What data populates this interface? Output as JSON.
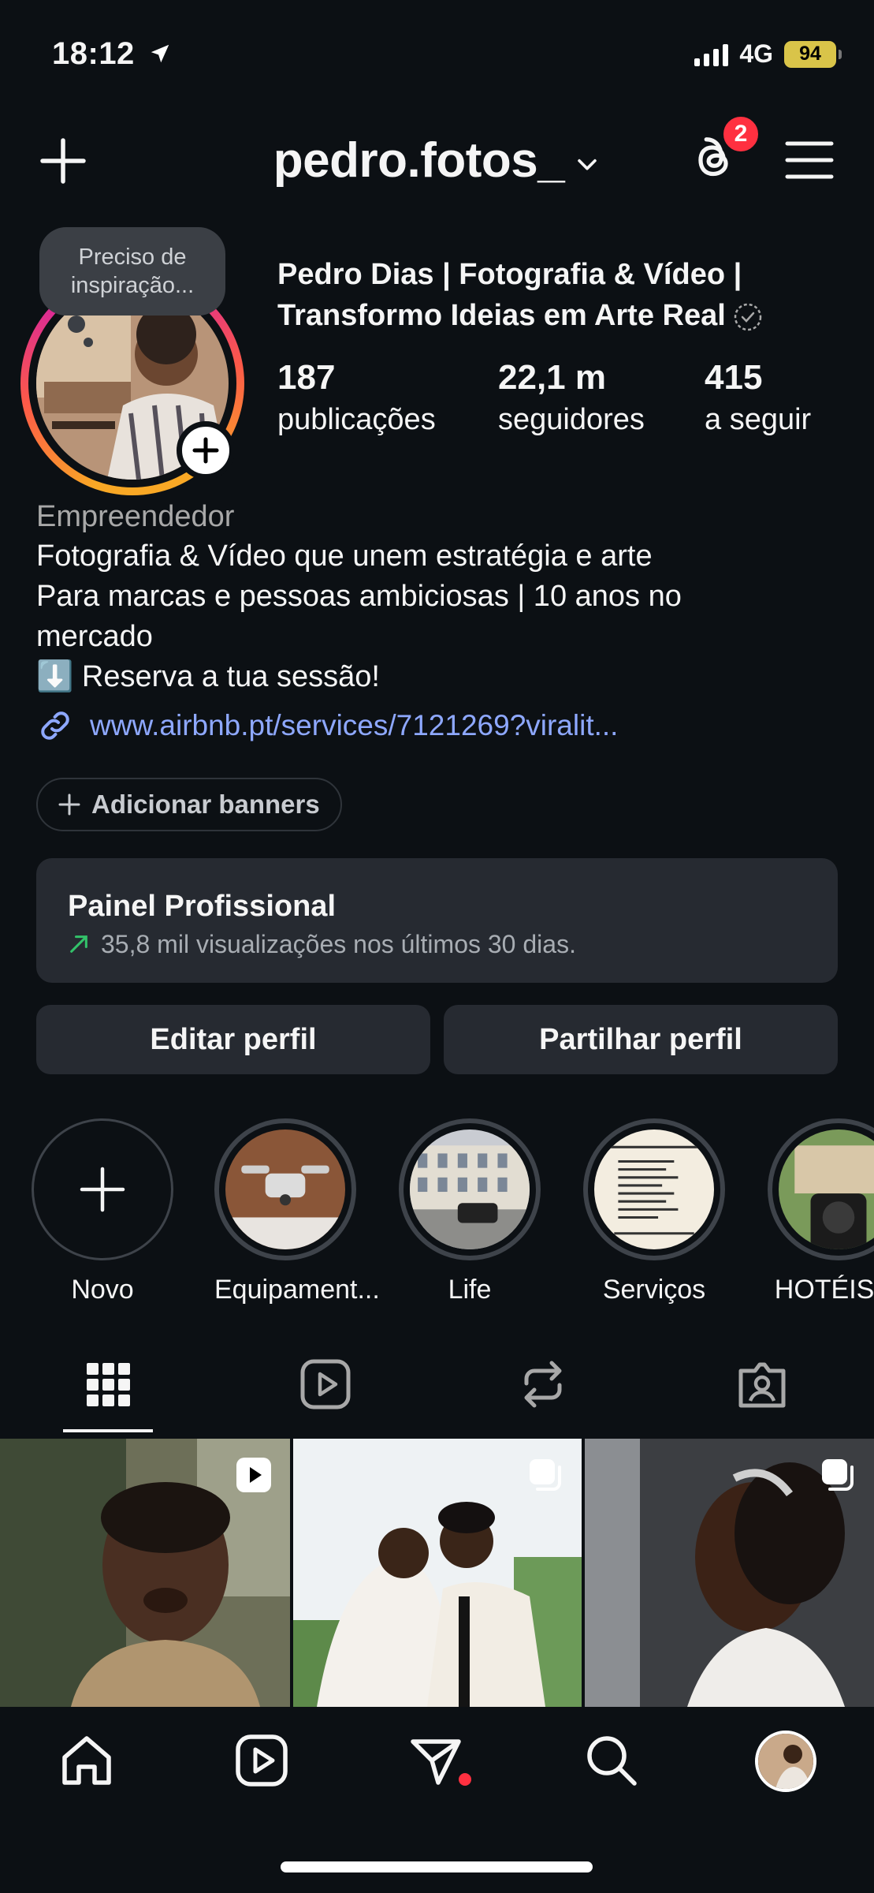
{
  "status_bar": {
    "time": "18:12",
    "network": "4G",
    "battery": "94"
  },
  "header": {
    "username": "pedro.fotos_",
    "threads_badge": "2"
  },
  "profile": {
    "note": "Preciso de inspiração...",
    "name_line1": "Pedro Dias | Fotografia & Vídeo |",
    "name_line2": "Transformo Ideias em Arte Real",
    "stats": [
      {
        "value": "187",
        "label": "publicações"
      },
      {
        "value": "22,1 m",
        "label": "seguidores"
      },
      {
        "value": "415",
        "label": "a seguir"
      }
    ],
    "category": "Empreendedor",
    "bio": "Fotografia & Vídeo que unem estratégia e arte\nPara marcas e pessoas ambiciosas | 10 anos no\nmercado\n⬇️ Reserva a tua sessão!",
    "link": "www.airbnb.pt/services/7121269?viralit...",
    "add_banners": "Adicionar banners"
  },
  "pro_panel": {
    "title": "Painel Profissional",
    "subtitle": "35,8 mil visualizações nos últimos 30 dias."
  },
  "buttons": {
    "edit": "Editar perfil",
    "share": "Partilhar perfil"
  },
  "highlights": [
    {
      "label": "Novo"
    },
    {
      "label": "Equipament..."
    },
    {
      "label": "Life"
    },
    {
      "label": "Serviços"
    },
    {
      "label": "HOTÉIS G"
    }
  ],
  "tabs": [
    "posts-grid-icon",
    "reels-icon",
    "reposts-icon",
    "tagged-icon"
  ],
  "colors": {
    "background": "#0c1014",
    "surface": "#262a31",
    "link": "#8ea8ff",
    "badge": "#ff3040"
  }
}
